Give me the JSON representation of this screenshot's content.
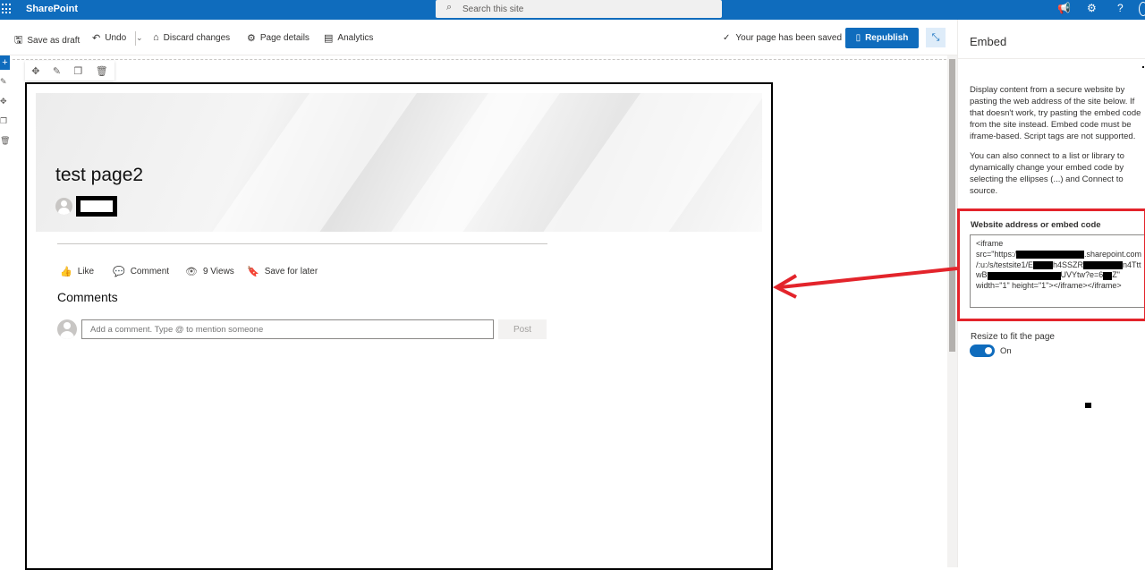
{
  "topbar": {
    "brand": "SharePoint",
    "search_placeholder": "Search this site",
    "icons": [
      "waffle-icon",
      "search-icon",
      "megaphone-icon",
      "gear-icon",
      "help-icon"
    ]
  },
  "commands": {
    "save_draft": "Save as draft",
    "undo": "Undo",
    "discard": "Discard changes",
    "page_details": "Page details",
    "analytics": "Analytics",
    "saved_status": "Your page has been saved",
    "republish": "Republish"
  },
  "page": {
    "title": "test page2",
    "social": {
      "like": "Like",
      "comment": "Comment",
      "views": "9 Views",
      "save_later": "Save for later"
    },
    "comments_title": "Comments",
    "comment_placeholder": "Add a comment. Type @ to mention someone",
    "post": "Post"
  },
  "panel": {
    "title": "Embed",
    "desc1": [
      "Display content from a secure website by",
      "pasting the web address of the site below. If",
      "that doesn't work, try pasting the embed code",
      "from the site instead. Embed code must be",
      "iframe-based. Script tags are not supported."
    ],
    "desc2": [
      "You can also connect to a list or library to",
      "dynamically change your embed code by",
      "selecting the ellipses (...) and Connect to",
      "source."
    ],
    "field_label": "Website address or embed code",
    "code": {
      "l1": "<iframe",
      "l2a": "src=\"https:/",
      "l2b": ".sharepoint.com",
      "l3a": "/:u:/s/testsite1/E",
      "l3b": "h4SSZR",
      "l3c": "n4Ttt",
      "l4a": "wB",
      "l4b": "UVYtw?e=6",
      "l4c": "Z\"",
      "l5": "width=\"1\" height=\"1\"></iframe></iframe>"
    },
    "resize_label": "Resize to fit the page",
    "toggle_state": "On"
  },
  "colors": {
    "brand_blue": "#0f6cbd",
    "annotation_red": "#e3242b"
  }
}
